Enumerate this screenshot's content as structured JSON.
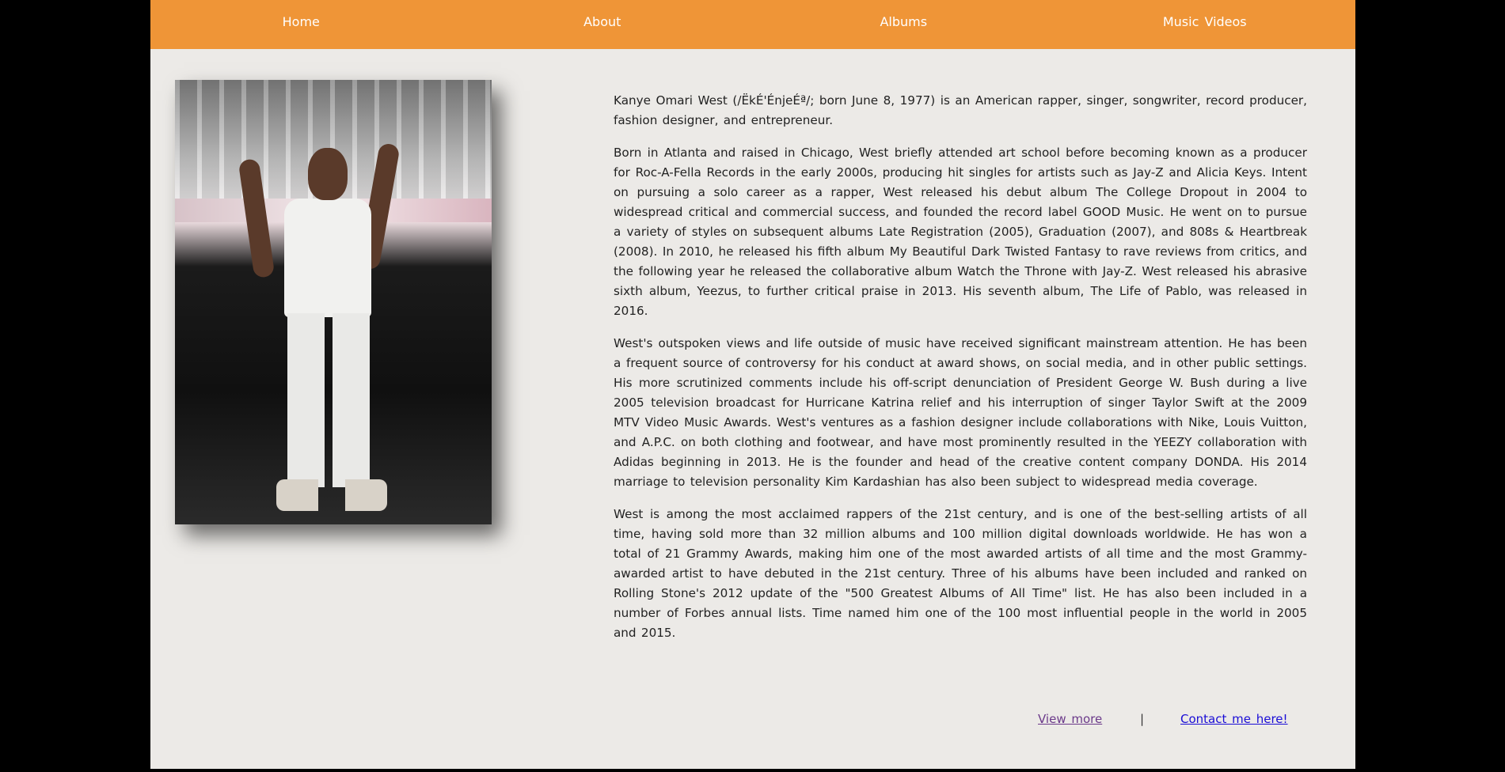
{
  "nav": {
    "items": [
      "Home",
      "About",
      "Albums",
      "Music  Videos"
    ]
  },
  "photo": {
    "description": "portrait-photo"
  },
  "bio": {
    "paragraphs": [
      "Kanye Omari West (/ËkÉ'ÉnjeÉª/; born June 8, 1977) is an American rapper, singer, songwriter, record producer, fashion designer, and entrepreneur.",
      "Born in Atlanta and raised in Chicago, West briefly attended art school before becoming known as a producer for Roc-A-Fella Records in the early 2000s, producing hit singles for artists such as Jay-Z and Alicia Keys. Intent on pursuing a solo career as a rapper, West released his debut album The College Dropout in 2004 to widespread critical and commercial success, and founded the record label GOOD Music. He went on to pursue a variety of styles on subsequent albums Late Registration (2005), Graduation (2007), and 808s & Heartbreak (2008). In 2010, he released his fifth album My Beautiful Dark Twisted Fantasy to rave reviews from critics, and the following year he released the collaborative album Watch the Throne with Jay-Z. West released his abrasive sixth album, Yeezus, to further critical praise in 2013. His seventh album, The Life of Pablo, was released in 2016.",
      "West's outspoken views and life outside of music have received significant mainstream attention. He has been a frequent source of controversy for his conduct at award shows, on social media, and in other public settings. His more scrutinized comments include his off-script denunciation of President George W. Bush during a live 2005 television broadcast for Hurricane Katrina relief and his interruption of singer Taylor Swift at the 2009 MTV Video Music Awards. West's ventures as a fashion designer include collaborations with Nike, Louis Vuitton, and A.P.C. on both clothing and footwear, and have most prominently resulted in the YEEZY collaboration with Adidas beginning in 2013. He is the founder and head of the creative content company DONDA. His 2014 marriage to television personality Kim Kardashian has also been subject to widespread media coverage.",
      "West is among the most acclaimed rappers of the 21st century, and is one of the best-selling artists of all time, having sold more than 32 million albums and 100 million digital downloads worldwide. He has won a total of 21 Grammy Awards, making him one of the most awarded artists of all time and the most Grammy-awarded artist to have debuted in the 21st century. Three of his albums have been included and ranked on Rolling Stone's 2012 update of the \"500 Greatest Albums of All Time\" list. He has also been included in a number of Forbes annual lists. Time named him one of the 100 most influential people in the world in 2005 and 2015."
    ]
  },
  "footer": {
    "view_more": "View  more",
    "separator": "|",
    "contact": "Contact  me  here!"
  },
  "colors": {
    "nav_bg": "#ef9537",
    "page_bg": "#eceae7",
    "outer_bg": "#000000",
    "visited_link": "#6b3a8a",
    "link": "#1a0dd6"
  }
}
